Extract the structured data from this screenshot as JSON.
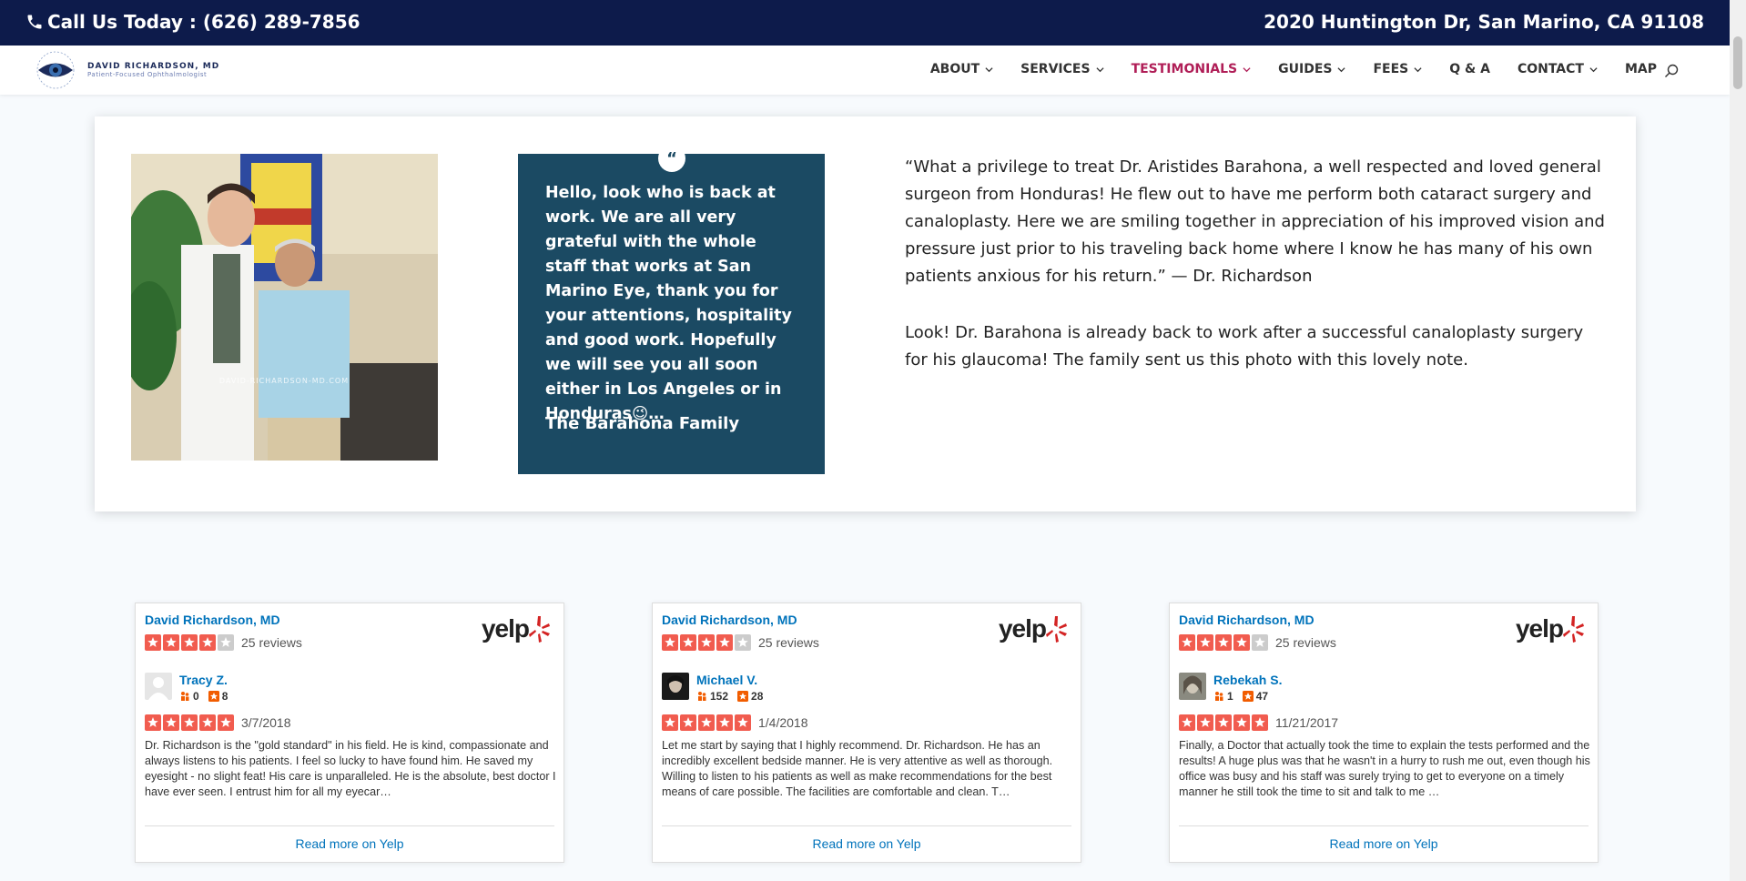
{
  "topbar": {
    "phone": "Call Us Today : (626) 289-7856",
    "address": "2020 Huntington Dr, San Marino, CA 91108",
    "bg_color": "#0d1b4b"
  },
  "logo": {
    "name": "DAVID RICHARDSON, MD",
    "tagline": "Patient-Focused Ophthalmologist"
  },
  "nav": {
    "items": [
      {
        "label": "ABOUT",
        "dropdown": true
      },
      {
        "label": "SERVICES",
        "dropdown": true
      },
      {
        "label": "TESTIMONIALS",
        "dropdown": true,
        "active": true
      },
      {
        "label": "GUIDES",
        "dropdown": true
      },
      {
        "label": "FEES",
        "dropdown": true
      },
      {
        "label": "Q & A",
        "dropdown": false
      },
      {
        "label": "CONTACT",
        "dropdown": true
      },
      {
        "label": "MAP",
        "dropdown": false
      }
    ],
    "active_color": "#b01e57"
  },
  "testimonial": {
    "photo_watermark": "DAVID-RICHARDSON-MD.COM",
    "quote_icon": "quote-icon",
    "quote_text": "Hello, look who is back at work. We are all very grateful with the whole staff that works at San Marino Eye, thank you for your attentions, hospitality and good work. Hopefully we will see you all soon either in Los Angeles or in Honduras😉…",
    "quote_author": "The Barahona Family",
    "quote_bg": "#1b4a63",
    "description_1": "“What a privilege to treat Dr. Aristides Barahona, a well respected and loved general surgeon from Honduras! He flew out to have me perform both cataract surgery and canaloplasty. Here we are smiling together in appreciation of his improved vision and pressure just prior to his traveling back home where I know he has many of his own patients anxious for his return.” — Dr. Richardson",
    "description_2": "Look! Dr. Barahona is already back to work after a successful canaloplasty surgery for his glaucoma! The family sent us this photo with this lovely note."
  },
  "yelp_widgets": [
    {
      "business": "David Richardson, MD",
      "business_rating": 4,
      "review_count": "25 reviews",
      "logo_text": "yelp",
      "reviewer": "Tracy Z.",
      "friends": "0",
      "reviews": "8",
      "rating": 5,
      "date": "3/7/2018",
      "text": "Dr. Richardson is the \"gold standard\" in his field. He is kind, compassionate and always listens to his patients. I feel so lucky to have found him. He saved my eyesight - no slight feat! His care is unparalleled. He is the absolute, best doctor I have ever seen. I entrust him for all my eyecar…",
      "read_more": "Read more on Yelp"
    },
    {
      "business": "David Richardson, MD",
      "business_rating": 4,
      "review_count": "25 reviews",
      "logo_text": "yelp",
      "reviewer": "Michael V.",
      "friends": "152",
      "reviews": "28",
      "rating": 5,
      "date": "1/4/2018",
      "text": "Let me start by saying that I highly recommend. Dr. Richardson. He has an incredibly excellent bedside manner. He is very attentive as well as thorough. Willing to listen to his patients as well as make recommendations for the best means of care possible. The facilities are comfortable and clean. T…",
      "read_more": "Read more on Yelp"
    },
    {
      "business": "David Richardson, MD",
      "business_rating": 4,
      "review_count": "25 reviews",
      "logo_text": "yelp",
      "reviewer": "Rebekah S.",
      "friends": "1",
      "reviews": "47",
      "rating": 5,
      "date": "11/21/2017",
      "text": "Finally, a Doctor that actually took the time to explain the tests performed and the results! A huge plus was that he wasn't in a hurry to rush me out, even though his office was busy and his staff was surely trying to get to everyone on a timely manner he still took the time to sit and talk to me …",
      "read_more": "Read more on Yelp"
    }
  ],
  "colors": {
    "yelp_red": "#d32323",
    "yelp_link": "#0073bb",
    "star_red": "#f15c4f",
    "star_empty": "#cccccc"
  }
}
